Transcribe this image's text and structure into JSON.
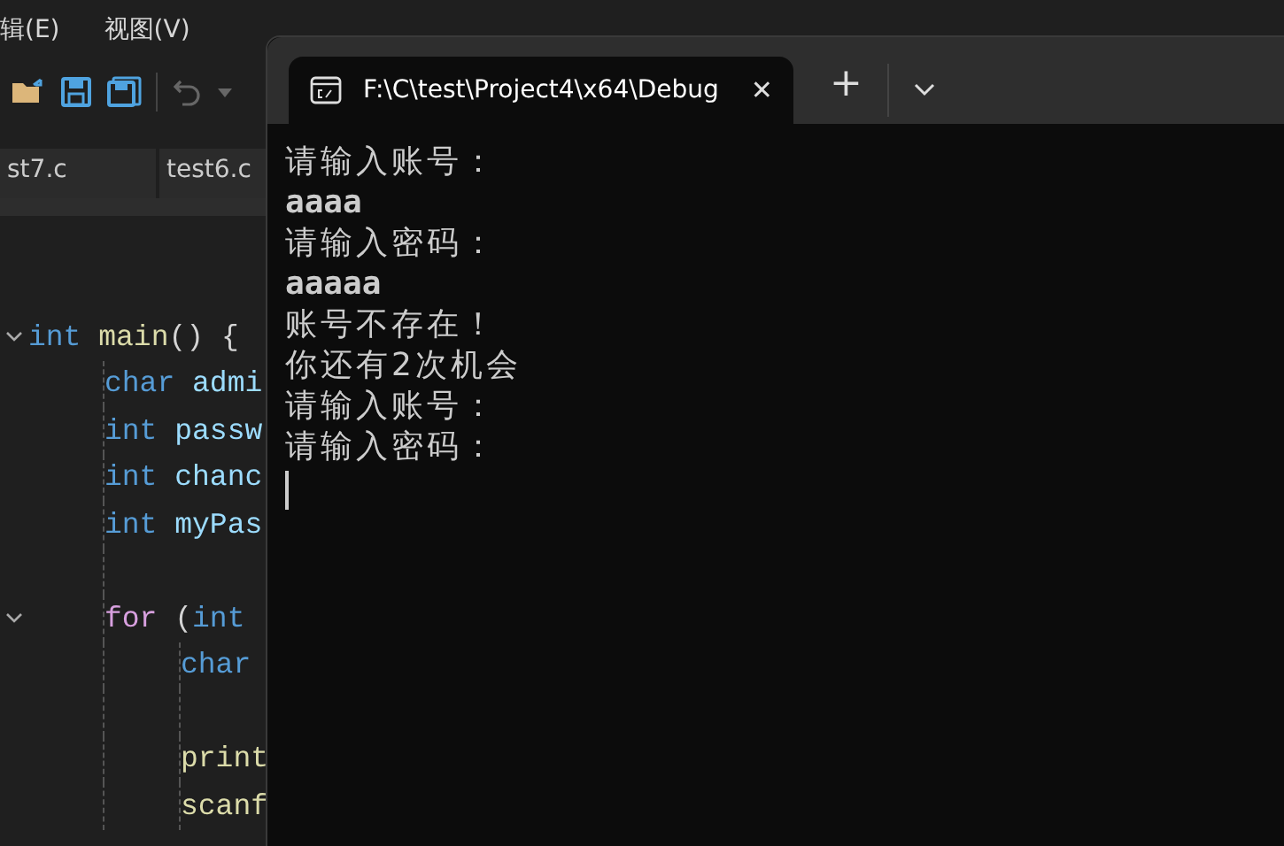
{
  "menu": [
    "辑(E)",
    "视图(V)"
  ],
  "editor_tabs": [
    {
      "label": "st7.c",
      "selected": false
    },
    {
      "label": "test6.c",
      "selected": false
    }
  ],
  "code": [
    {
      "kind": "code",
      "expanded": true,
      "tokens": [
        {
          "kind": "keyword",
          "text": "int"
        },
        {
          "kind": "function",
          "text": " main"
        },
        {
          "kind": "plain",
          "text": "() {"
        }
      ],
      "children": [
        {
          "kind": "code",
          "tokens": [
            {
              "kind": "keyword",
              "text": "char"
            },
            {
              "kind": "ident",
              "text": " admi"
            }
          ]
        },
        {
          "kind": "code",
          "tokens": [
            {
              "kind": "keyword",
              "text": "int"
            },
            {
              "kind": "ident",
              "text": " passw"
            }
          ]
        },
        {
          "kind": "code",
          "tokens": [
            {
              "kind": "keyword",
              "text": "int"
            },
            {
              "kind": "ident",
              "text": " chanc"
            }
          ]
        },
        {
          "kind": "code",
          "tokens": [
            {
              "kind": "keyword",
              "text": "int"
            },
            {
              "kind": "ident",
              "text": " myPas"
            }
          ]
        },
        {
          "kind": "blank"
        },
        {
          "kind": "code",
          "expanded": true,
          "tokens": [
            {
              "kind": "control",
              "text": "for"
            },
            {
              "kind": "plain",
              "text": " ("
            },
            {
              "kind": "keyword",
              "text": "int"
            }
          ],
          "children": [
            {
              "kind": "code",
              "tokens": [
                {
                  "kind": "keyword",
                  "text": "char"
                }
              ]
            },
            {
              "kind": "blank"
            },
            {
              "kind": "code",
              "tokens": [
                {
                  "kind": "function",
                  "text": "print"
                }
              ]
            },
            {
              "kind": "code",
              "tokens": [
                {
                  "kind": "function",
                  "text": "scanf"
                }
              ]
            }
          ]
        }
      ]
    }
  ],
  "terminal": {
    "tab": {
      "title": "F:\\C\\test\\Project4\\x64\\Debug",
      "close": "✕",
      "selected": true
    },
    "new_tab": "+",
    "lines": [
      {
        "kind": "output",
        "text": "请输入账号："
      },
      {
        "kind": "input",
        "text": "aaaa"
      },
      {
        "kind": "output",
        "text": "请输入密码："
      },
      {
        "kind": "input",
        "text": "aaaaa"
      },
      {
        "kind": "output",
        "text": "账号不存在！"
      },
      {
        "kind": "output",
        "text": "你还有2次机会"
      },
      {
        "kind": "output",
        "text": "请输入账号："
      },
      {
        "kind": "output",
        "text": "请输入密码："
      }
    ]
  }
}
